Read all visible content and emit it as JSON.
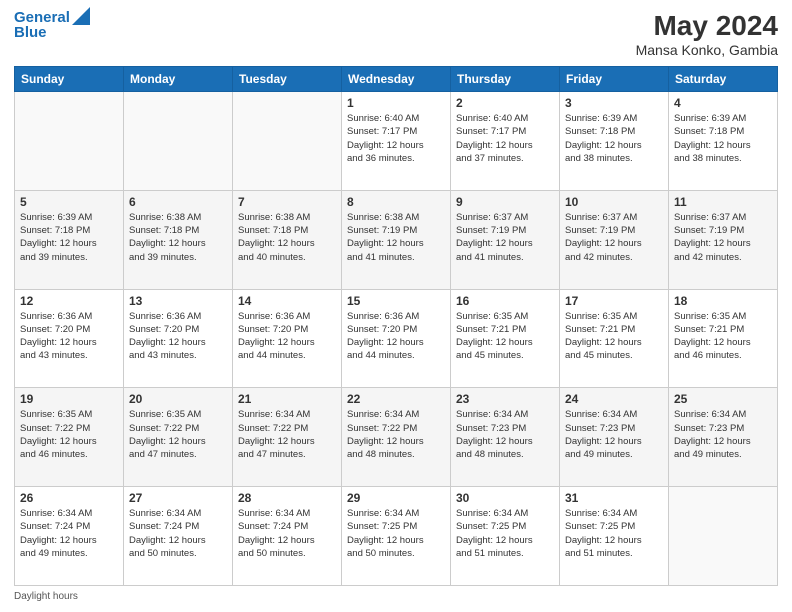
{
  "header": {
    "logo_line1": "General",
    "logo_line2": "Blue",
    "title": "May 2024",
    "subtitle": "Mansa Konko, Gambia"
  },
  "days_of_week": [
    "Sunday",
    "Monday",
    "Tuesday",
    "Wednesday",
    "Thursday",
    "Friday",
    "Saturday"
  ],
  "footer_text": "Daylight hours",
  "weeks": [
    [
      {
        "day": "",
        "info": ""
      },
      {
        "day": "",
        "info": ""
      },
      {
        "day": "",
        "info": ""
      },
      {
        "day": "1",
        "info": "Sunrise: 6:40 AM\nSunset: 7:17 PM\nDaylight: 12 hours\nand 36 minutes."
      },
      {
        "day": "2",
        "info": "Sunrise: 6:40 AM\nSunset: 7:17 PM\nDaylight: 12 hours\nand 37 minutes."
      },
      {
        "day": "3",
        "info": "Sunrise: 6:39 AM\nSunset: 7:18 PM\nDaylight: 12 hours\nand 38 minutes."
      },
      {
        "day": "4",
        "info": "Sunrise: 6:39 AM\nSunset: 7:18 PM\nDaylight: 12 hours\nand 38 minutes."
      }
    ],
    [
      {
        "day": "5",
        "info": "Sunrise: 6:39 AM\nSunset: 7:18 PM\nDaylight: 12 hours\nand 39 minutes."
      },
      {
        "day": "6",
        "info": "Sunrise: 6:38 AM\nSunset: 7:18 PM\nDaylight: 12 hours\nand 39 minutes."
      },
      {
        "day": "7",
        "info": "Sunrise: 6:38 AM\nSunset: 7:18 PM\nDaylight: 12 hours\nand 40 minutes."
      },
      {
        "day": "8",
        "info": "Sunrise: 6:38 AM\nSunset: 7:19 PM\nDaylight: 12 hours\nand 41 minutes."
      },
      {
        "day": "9",
        "info": "Sunrise: 6:37 AM\nSunset: 7:19 PM\nDaylight: 12 hours\nand 41 minutes."
      },
      {
        "day": "10",
        "info": "Sunrise: 6:37 AM\nSunset: 7:19 PM\nDaylight: 12 hours\nand 42 minutes."
      },
      {
        "day": "11",
        "info": "Sunrise: 6:37 AM\nSunset: 7:19 PM\nDaylight: 12 hours\nand 42 minutes."
      }
    ],
    [
      {
        "day": "12",
        "info": "Sunrise: 6:36 AM\nSunset: 7:20 PM\nDaylight: 12 hours\nand 43 minutes."
      },
      {
        "day": "13",
        "info": "Sunrise: 6:36 AM\nSunset: 7:20 PM\nDaylight: 12 hours\nand 43 minutes."
      },
      {
        "day": "14",
        "info": "Sunrise: 6:36 AM\nSunset: 7:20 PM\nDaylight: 12 hours\nand 44 minutes."
      },
      {
        "day": "15",
        "info": "Sunrise: 6:36 AM\nSunset: 7:20 PM\nDaylight: 12 hours\nand 44 minutes."
      },
      {
        "day": "16",
        "info": "Sunrise: 6:35 AM\nSunset: 7:21 PM\nDaylight: 12 hours\nand 45 minutes."
      },
      {
        "day": "17",
        "info": "Sunrise: 6:35 AM\nSunset: 7:21 PM\nDaylight: 12 hours\nand 45 minutes."
      },
      {
        "day": "18",
        "info": "Sunrise: 6:35 AM\nSunset: 7:21 PM\nDaylight: 12 hours\nand 46 minutes."
      }
    ],
    [
      {
        "day": "19",
        "info": "Sunrise: 6:35 AM\nSunset: 7:22 PM\nDaylight: 12 hours\nand 46 minutes."
      },
      {
        "day": "20",
        "info": "Sunrise: 6:35 AM\nSunset: 7:22 PM\nDaylight: 12 hours\nand 47 minutes."
      },
      {
        "day": "21",
        "info": "Sunrise: 6:34 AM\nSunset: 7:22 PM\nDaylight: 12 hours\nand 47 minutes."
      },
      {
        "day": "22",
        "info": "Sunrise: 6:34 AM\nSunset: 7:22 PM\nDaylight: 12 hours\nand 48 minutes."
      },
      {
        "day": "23",
        "info": "Sunrise: 6:34 AM\nSunset: 7:23 PM\nDaylight: 12 hours\nand 48 minutes."
      },
      {
        "day": "24",
        "info": "Sunrise: 6:34 AM\nSunset: 7:23 PM\nDaylight: 12 hours\nand 49 minutes."
      },
      {
        "day": "25",
        "info": "Sunrise: 6:34 AM\nSunset: 7:23 PM\nDaylight: 12 hours\nand 49 minutes."
      }
    ],
    [
      {
        "day": "26",
        "info": "Sunrise: 6:34 AM\nSunset: 7:24 PM\nDaylight: 12 hours\nand 49 minutes."
      },
      {
        "day": "27",
        "info": "Sunrise: 6:34 AM\nSunset: 7:24 PM\nDaylight: 12 hours\nand 50 minutes."
      },
      {
        "day": "28",
        "info": "Sunrise: 6:34 AM\nSunset: 7:24 PM\nDaylight: 12 hours\nand 50 minutes."
      },
      {
        "day": "29",
        "info": "Sunrise: 6:34 AM\nSunset: 7:25 PM\nDaylight: 12 hours\nand 50 minutes."
      },
      {
        "day": "30",
        "info": "Sunrise: 6:34 AM\nSunset: 7:25 PM\nDaylight: 12 hours\nand 51 minutes."
      },
      {
        "day": "31",
        "info": "Sunrise: 6:34 AM\nSunset: 7:25 PM\nDaylight: 12 hours\nand 51 minutes."
      },
      {
        "day": "",
        "info": ""
      }
    ]
  ]
}
